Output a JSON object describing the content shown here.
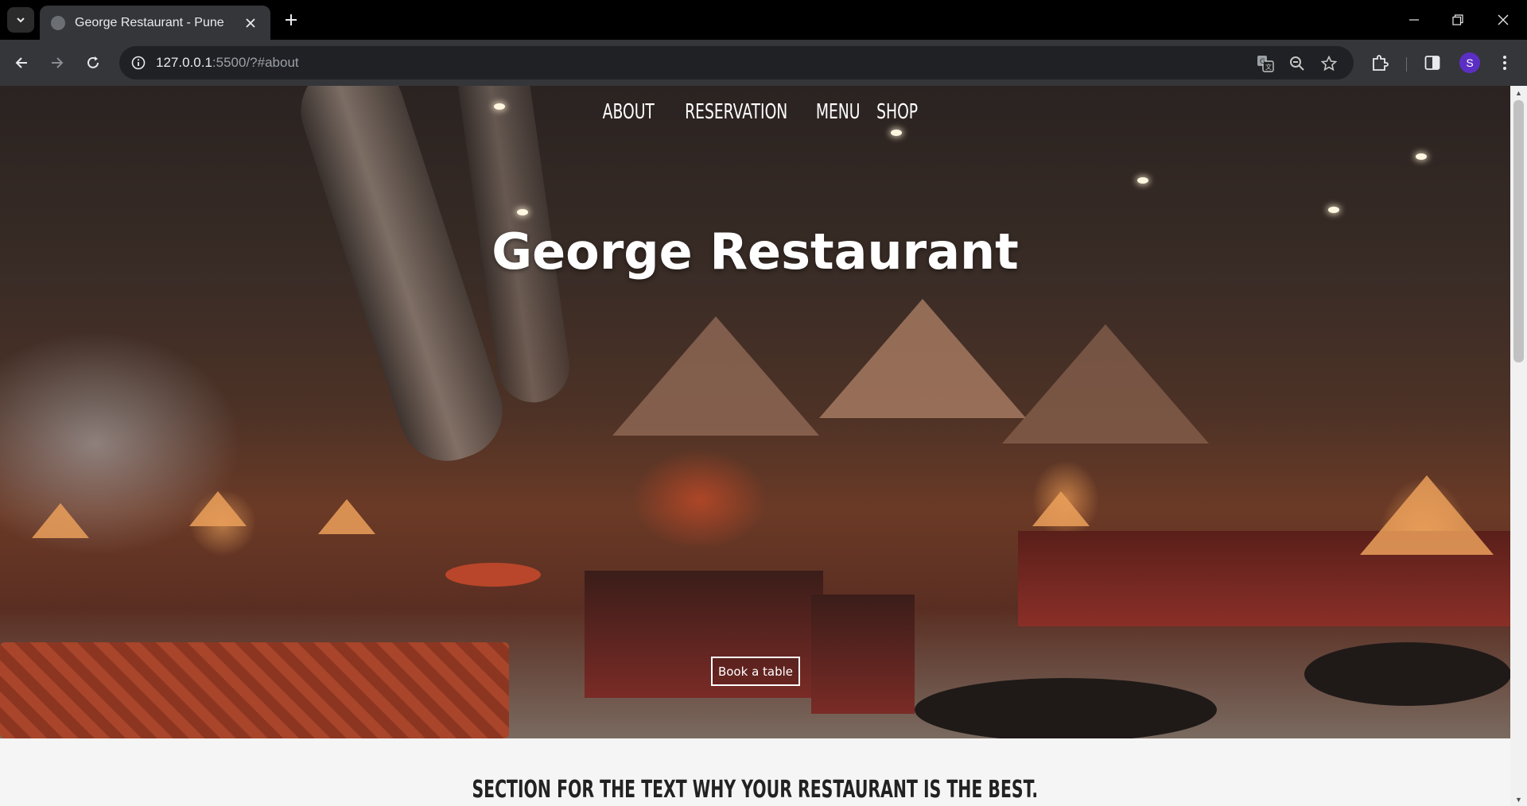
{
  "browser": {
    "tab_title": "George Restaurant - Pune",
    "url_host": "127.0.0.1",
    "url_rest": ":5500/?#about",
    "profile_initial": "S"
  },
  "nav": {
    "items": [
      {
        "label": "ABOUT"
      },
      {
        "label": "RESERVATION"
      },
      {
        "label": "MENU"
      },
      {
        "label": "SHOP"
      }
    ]
  },
  "hero": {
    "title": "George Restaurant",
    "cta_label": "Book a table"
  },
  "section": {
    "heading": "SECTION FOR THE TEXT WHY YOUR RESTAURANT IS THE BEST."
  },
  "icons": {
    "tab_search": "chevron-down-icon",
    "back": "arrow-left-icon",
    "forward": "arrow-right-icon",
    "reload": "reload-icon",
    "site_info": "info-icon",
    "translate": "translate-icon",
    "zoom": "zoom-out-icon",
    "bookmark": "star-icon",
    "extensions": "puzzle-icon",
    "sidebar": "side-panel-icon",
    "menu": "kebab-menu-icon"
  },
  "colors": {
    "chrome_dark": "#000000",
    "toolbar": "#35363a",
    "omnibox": "#202124",
    "avatar": "#5b2fc4",
    "page_bg": "#f5f5f5"
  }
}
